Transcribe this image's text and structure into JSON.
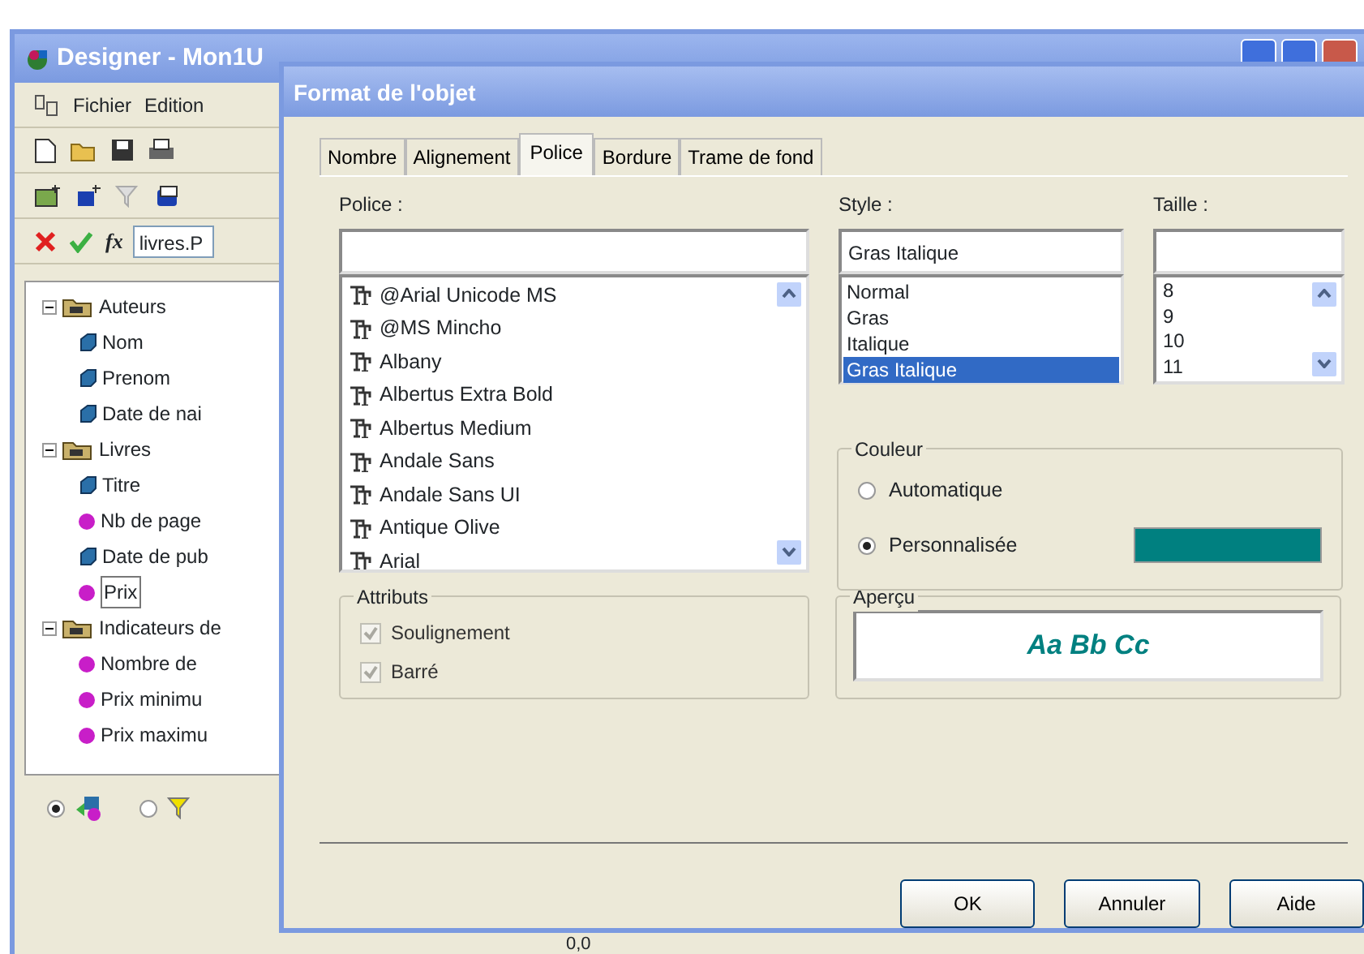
{
  "window": {
    "title": "Designer - Mon1U"
  },
  "menu": [
    "Fichier",
    "Edition"
  ],
  "formula": {
    "symbol": "fx",
    "value": "livres.P"
  },
  "tree": [
    {
      "label": "Auteurs",
      "kind": "class",
      "expanded": true,
      "selected": false,
      "children": [
        {
          "label": "Nom",
          "kind": "dimension",
          "selected": false
        },
        {
          "label": "Prenom",
          "kind": "dimension",
          "selected": false
        },
        {
          "label": "Date de nai",
          "kind": "dimension",
          "selected": false
        }
      ]
    },
    {
      "label": "Livres",
      "kind": "class",
      "expanded": true,
      "selected": false,
      "children": [
        {
          "label": "Titre",
          "kind": "dimension",
          "selected": false
        },
        {
          "label": "Nb de page",
          "kind": "measure",
          "selected": false
        },
        {
          "label": "Date de pub",
          "kind": "dimension",
          "selected": false
        },
        {
          "label": "Prix",
          "kind": "measure",
          "selected": true
        }
      ]
    },
    {
      "label": "Indicateurs de",
      "kind": "class",
      "expanded": true,
      "selected": false,
      "children": [
        {
          "label": "Nombre de",
          "kind": "measure",
          "selected": false
        },
        {
          "label": "Prix minimu",
          "kind": "measure",
          "selected": false
        },
        {
          "label": "Prix maximu",
          "kind": "measure",
          "selected": false
        }
      ]
    }
  ],
  "view_options": [
    {
      "kind": "objects",
      "selected": true
    },
    {
      "kind": "filter",
      "selected": false
    }
  ],
  "status_bar": {
    "text": "0,0"
  },
  "dialog": {
    "title": "Format de l'objet",
    "tabs": [
      {
        "label": "Nombre",
        "selected": false
      },
      {
        "label": "Alignement",
        "selected": false
      },
      {
        "label": "Police",
        "selected": true
      },
      {
        "label": "Bordure",
        "selected": false
      },
      {
        "label": "Trame de fond",
        "selected": false
      }
    ],
    "font": {
      "label": "Police :",
      "items": [
        "@Arial Unicode MS",
        "@MS Mincho",
        "Albany",
        "Albertus Extra Bold",
        "Albertus Medium",
        "Andale Sans",
        "Andale Sans UI",
        "Antique Olive",
        "Arial"
      ]
    },
    "style": {
      "label": "Style :",
      "value": "Gras Italique",
      "items": [
        {
          "label": "Normal",
          "selected": false
        },
        {
          "label": "Gras",
          "selected": false
        },
        {
          "label": "Italique",
          "selected": false
        },
        {
          "label": "Gras Italique",
          "selected": true
        }
      ]
    },
    "size": {
      "label": "Taille :",
      "items": [
        "8",
        "9",
        "10",
        "11"
      ]
    },
    "couleur": {
      "title": "Couleur",
      "options": [
        {
          "label": "Automatique",
          "selected": false
        },
        {
          "label": "Personnalisée",
          "selected": true
        }
      ],
      "color": "#008080"
    },
    "attributes": {
      "title": "Attributs",
      "items": [
        {
          "label": "Soulignement",
          "checked": true,
          "disabled": true
        },
        {
          "label": "Barré",
          "checked": true,
          "disabled": true
        }
      ]
    },
    "preview": {
      "title": "Aperçu",
      "sample": "Aa Bb Cc",
      "bold": true,
      "italic": true
    },
    "buttons": [
      "OK",
      "Annuler",
      "Aide"
    ]
  }
}
